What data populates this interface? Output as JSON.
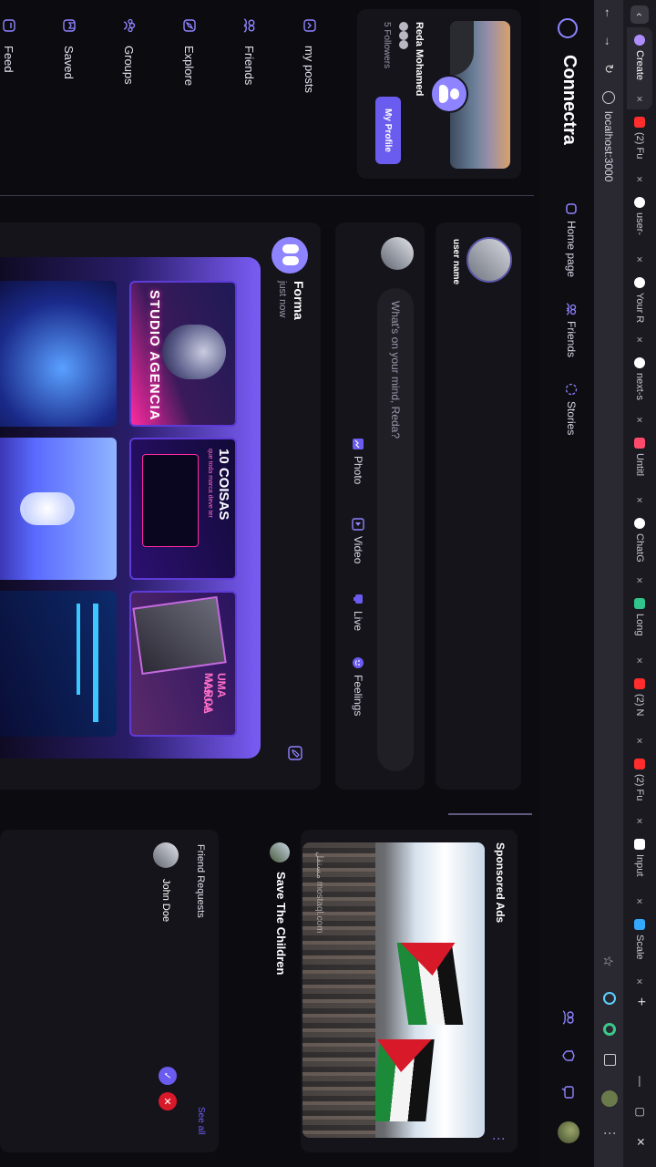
{
  "browser": {
    "tabs": [
      {
        "label": "Create",
        "color": "#b08cff",
        "active": true
      },
      {
        "label": "(2) Fu",
        "color": "#ff2d2d"
      },
      {
        "label": "user-",
        "color": "#ffffff"
      },
      {
        "label": "Your R",
        "color": "#ffffff"
      },
      {
        "label": "next-s",
        "color": "#ffffff"
      },
      {
        "label": "Untitl",
        "color": "#ff4a6b"
      },
      {
        "label": "ChatG",
        "color": "#ffffff"
      },
      {
        "label": "Long",
        "color": "#32c48d"
      },
      {
        "label": "(2) N",
        "color": "#ff2d2d"
      },
      {
        "label": "(2) Fu",
        "color": "#ff2d2d"
      },
      {
        "label": "Input",
        "color": "#ffffff"
      },
      {
        "label": "Scale",
        "color": "#33a8ff"
      }
    ],
    "new_tab": "+",
    "url": "localhost:3000"
  },
  "app": {
    "brand": "Connectra",
    "nav": {
      "home": "Home page",
      "friends": "Friends",
      "stories": "Stories"
    }
  },
  "profile": {
    "name": "Reda Mohamed",
    "followers": "5 Followers",
    "button": "My Profile"
  },
  "sidebar": {
    "items": [
      "my posts",
      "Friends",
      "Explore",
      "Groups",
      "Saved",
      "Feed"
    ]
  },
  "story": {
    "user": "user name"
  },
  "composer": {
    "placeholder": "What's on your mind, Reda?",
    "actions": [
      "Photo",
      "Video",
      "Live",
      "Feelings"
    ]
  },
  "post": {
    "author": "Forma",
    "time": "just now",
    "image_texts": {
      "top_left": "STUDIO AGENCIA",
      "top_middle": "10 COISAS",
      "top_right": "UMA MARCA",
      "top_right_sub": "VISUAL",
      "top_middle_sub": "que toda marca deve ter"
    }
  },
  "ads": {
    "title": "Sponsored Ads",
    "more": "⋮",
    "ad_title": "Save The Children",
    "watermark": "مستقل mostaql.com"
  },
  "friend_requests": {
    "title": "Friend Requests",
    "see_all": "See all",
    "items": [
      {
        "name": "John Doe"
      }
    ]
  },
  "colors": {
    "accent": "#6b5cf0",
    "accent_light": "#8f84ff",
    "reject": "#d8192a",
    "bg": "#0c0b10",
    "card": "#15141a"
  }
}
